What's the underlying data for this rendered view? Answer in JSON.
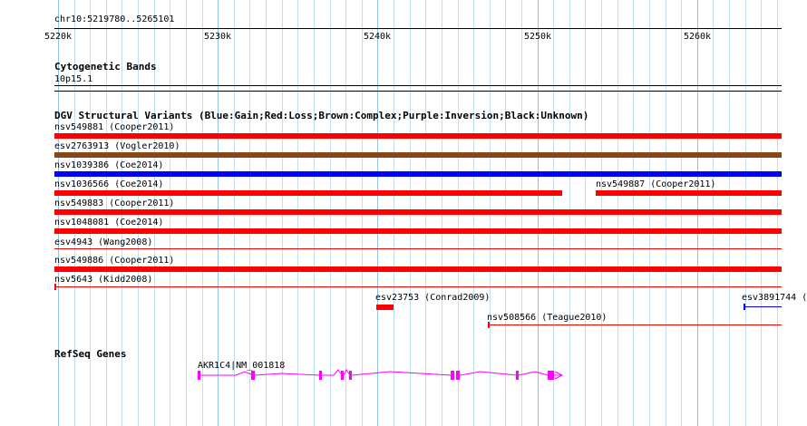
{
  "ruler": {
    "range_label": "chr10:5219780..5265101",
    "ticks": [
      "5220k",
      "5230k",
      "5240k",
      "5250k",
      "5260k"
    ]
  },
  "cytoband": {
    "title": "Cytogenetic Bands",
    "band": "10p15.1"
  },
  "dgv": {
    "title": "DGV Structural Variants (Blue:Gain;Red:Loss;Brown:Complex;Purple:Inversion;Black:Unknown)",
    "colors": {
      "loss": "#ff0000",
      "gain": "#0000ff",
      "complex": "#8b4513"
    },
    "features": [
      {
        "label": "nsv549881 (Cooper2011)",
        "type": "loss"
      },
      {
        "label": "esv2763913 (Vogler2010)",
        "type": "complex"
      },
      {
        "label": "nsv1039386 (Coe2014)",
        "type": "gain"
      },
      {
        "label": "nsv1036566 (Coe2014)",
        "type": "loss"
      },
      {
        "label": "nsv549887 (Cooper2011)",
        "type": "loss"
      },
      {
        "label": "nsv549883 (Cooper2011)",
        "type": "loss"
      },
      {
        "label": "nsv1048081 (Coe2014)",
        "type": "loss"
      },
      {
        "label": "esv4943 (Wang2008)",
        "type": "loss"
      },
      {
        "label": "nsv549886 (Cooper2011)",
        "type": "loss"
      },
      {
        "label": "nsv5643 (Kidd2008)",
        "type": "loss"
      },
      {
        "label": "esv23753 (Conrad2009)",
        "type": "loss"
      },
      {
        "label": "nsv508566 (Teague2010)",
        "type": "loss"
      },
      {
        "label": "esv3891744 (",
        "type": "gain"
      }
    ]
  },
  "refseq": {
    "title": "RefSeq Genes",
    "color": "#ff00ff",
    "gene_label": "AKR1C4|NM_001818"
  }
}
